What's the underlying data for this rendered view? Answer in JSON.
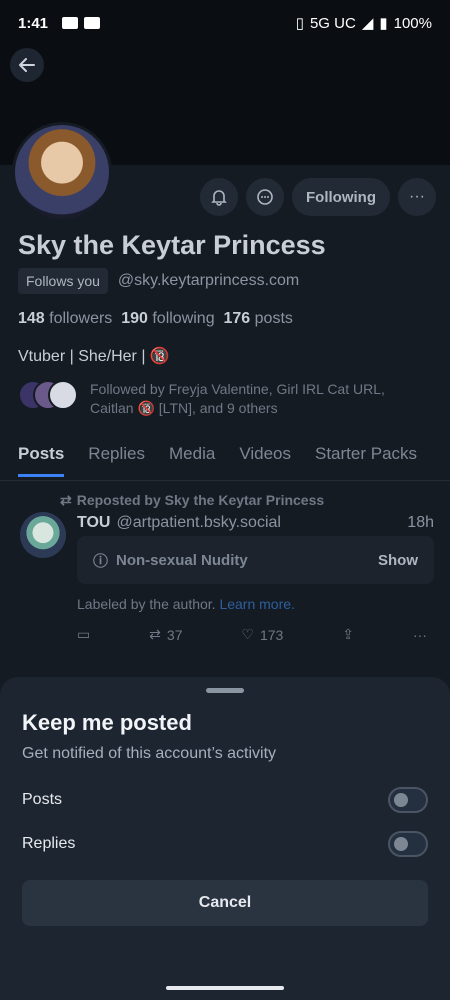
{
  "status_bar": {
    "time": "1:41",
    "network": "5G UC",
    "battery": "100%"
  },
  "profile": {
    "display_name": "Sky the Keytar Princess",
    "follows_you_badge": "Follows you",
    "handle": "@sky.keytarprincess.com",
    "followers_count": "148",
    "followers_label": "followers",
    "following_count": "190",
    "following_label": "following",
    "posts_count": "176",
    "posts_label": "posts",
    "bio": "Vtuber | She/Her | 🔞",
    "followed_by": "Followed by Freyja Valentine, Girl IRL Cat URL, Caitlan 🔞 [LTN], and 9 others",
    "follow_button": "Following"
  },
  "tabs": [
    "Posts",
    "Replies",
    "Media",
    "Videos",
    "Starter Packs"
  ],
  "post": {
    "repost_label": "Reposted by Sky the Keytar Princess",
    "author": "TOU",
    "author_handle": "@artpatient.bsky.social",
    "time": "18h",
    "content_warning": "Non-sexual Nudity",
    "show_label": "Show",
    "labeled_text": "Labeled by the author.",
    "learn_more": "Learn more.",
    "reposts": "37",
    "likes": "173"
  },
  "sheet": {
    "title": "Keep me posted",
    "subtitle": "Get notified of this account’s activity",
    "posts_label": "Posts",
    "replies_label": "Replies",
    "posts_enabled": false,
    "replies_enabled": false,
    "cancel_label": "Cancel"
  }
}
